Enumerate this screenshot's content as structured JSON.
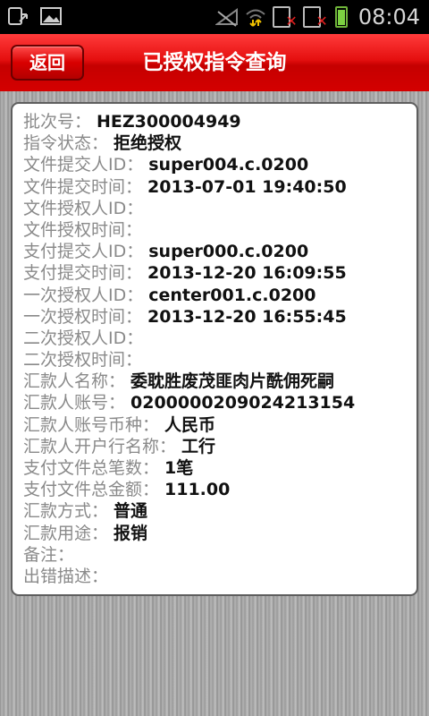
{
  "status_bar": {
    "time": "08:04",
    "icons": [
      "usb-debug-icon",
      "image-icon",
      "no-signal-icon",
      "wifi-icon",
      "sim1-error-icon",
      "sim2-error-icon",
      "battery-icon"
    ]
  },
  "header": {
    "back_label": "返回",
    "title": "已授权指令查询"
  },
  "details": [
    {
      "label": "批次号：",
      "value": "HEZ300004949"
    },
    {
      "label": "指令状态：",
      "value": "拒绝授权"
    },
    {
      "label": "文件提交人ID：",
      "value": "super004.c.0200"
    },
    {
      "label": "文件提交时间：",
      "value": "2013-07-01 19:40:50"
    },
    {
      "label": "文件授权人ID：",
      "value": ""
    },
    {
      "label": "文件授权时间：",
      "value": ""
    },
    {
      "label": "支付提交人ID：",
      "value": "super000.c.0200"
    },
    {
      "label": "支付提交时间：",
      "value": "2013-12-20 16:09:55"
    },
    {
      "label": "一次授权人ID：",
      "value": "center001.c.0200"
    },
    {
      "label": "一次授权时间：",
      "value": "2013-12-20 16:55:45"
    },
    {
      "label": "二次授权人ID：",
      "value": ""
    },
    {
      "label": "二次授权时间：",
      "value": ""
    },
    {
      "label": "汇款人名称：",
      "value": "委耽胜废茂匪肉片酰佣死嗣"
    },
    {
      "label": "汇款人账号：",
      "value": "0200000209024213154"
    },
    {
      "label": "汇款人账号币种：",
      "value": "人民币"
    },
    {
      "label": "汇款人开户行名称：",
      "value": "工行"
    },
    {
      "label": "支付文件总笔数：",
      "value": "1笔"
    },
    {
      "label": "支付文件总金额：",
      "value": "111.00"
    },
    {
      "label": "汇款方式：",
      "value": "普通"
    },
    {
      "label": "汇款用途：",
      "value": "报销"
    },
    {
      "label": "备注：",
      "value": ""
    },
    {
      "label": "出错描述：",
      "value": ""
    }
  ]
}
